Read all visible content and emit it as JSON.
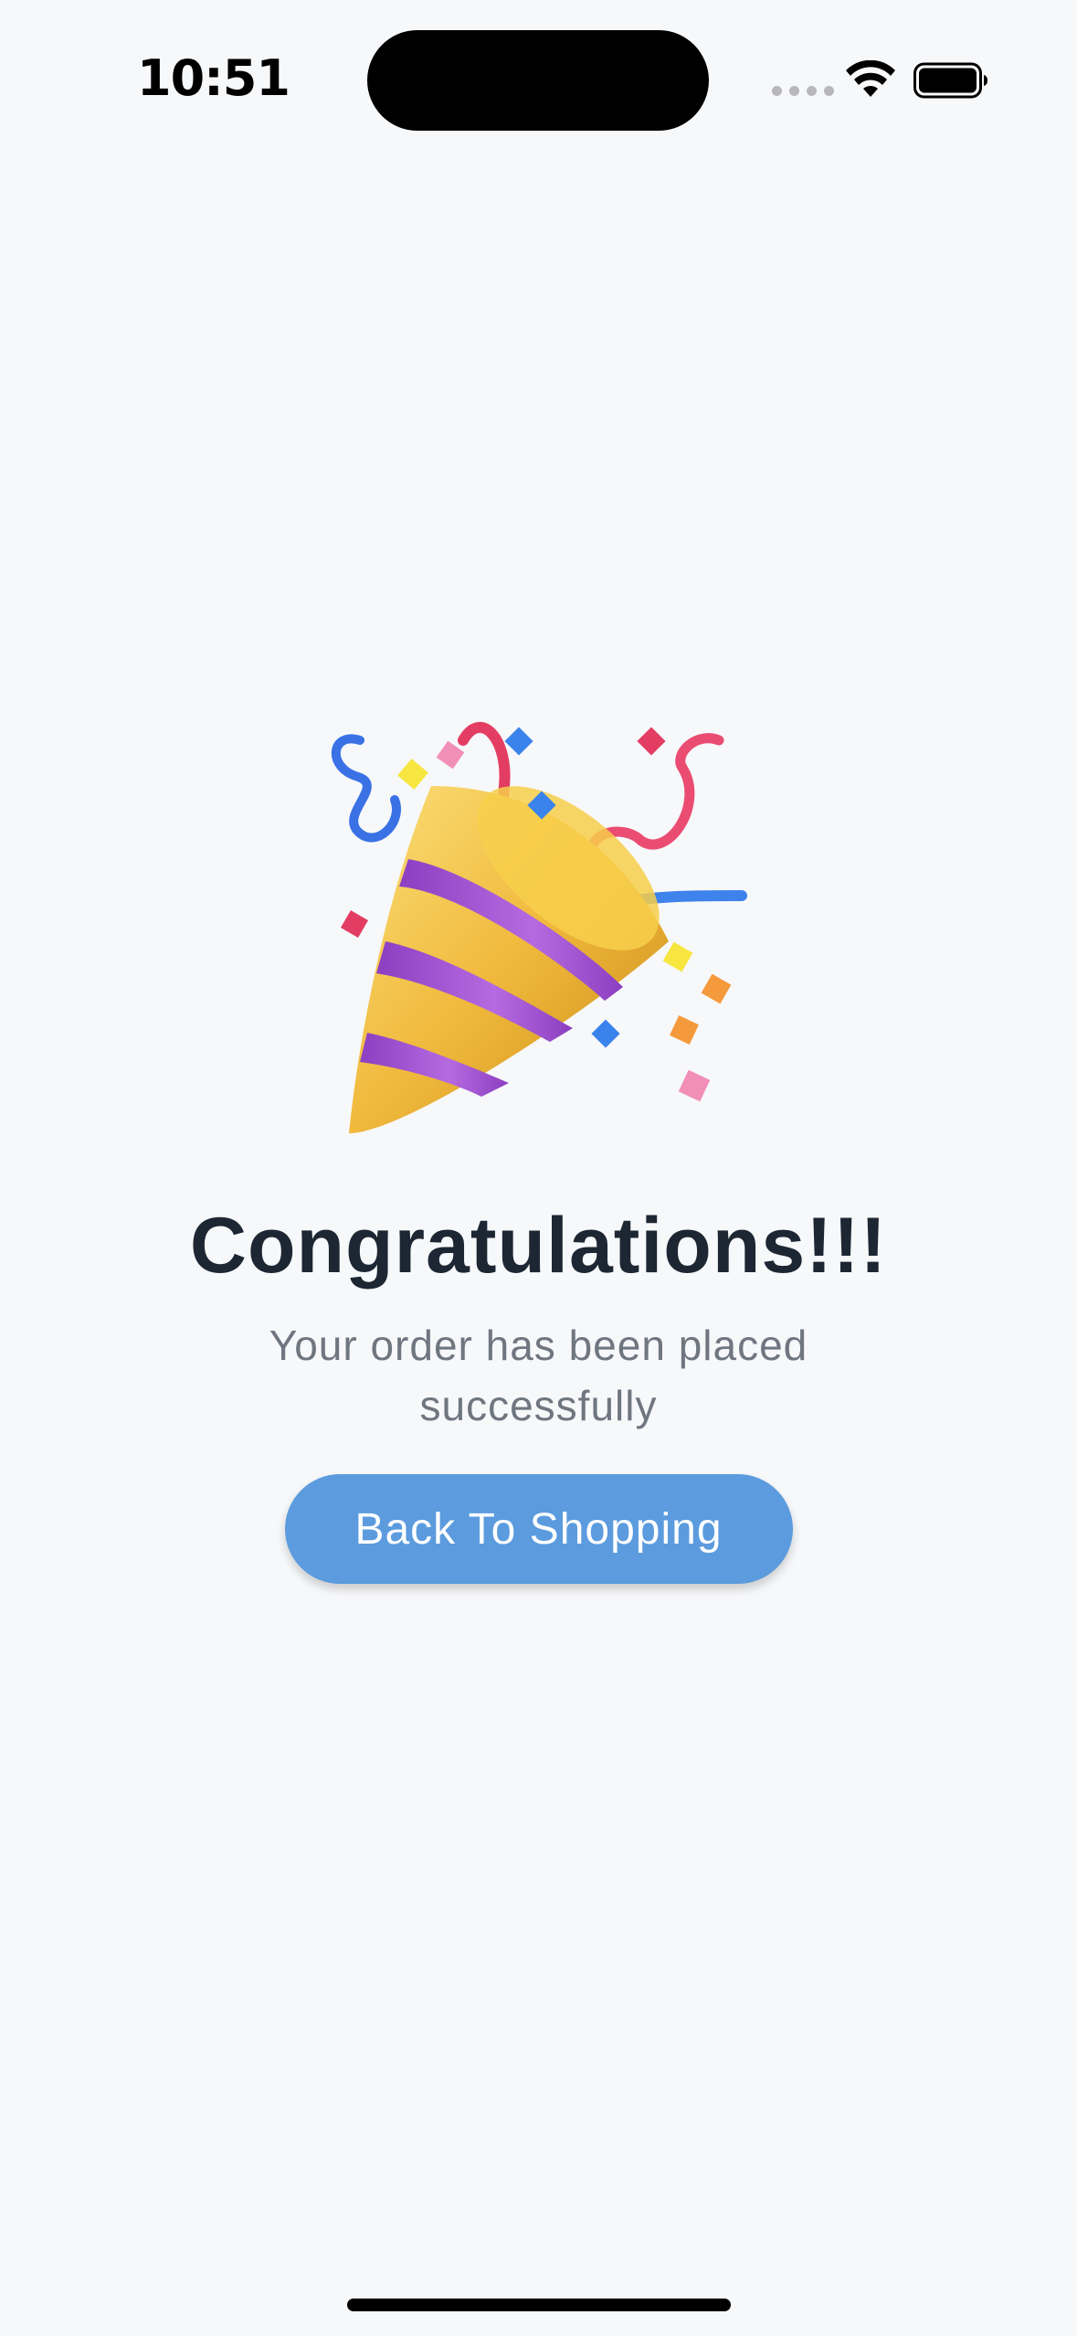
{
  "status_bar": {
    "time": "10:51"
  },
  "success": {
    "icon": "party-popper-icon",
    "title": "Congratulations!!!",
    "message": "Your order has been placed successfully",
    "button_label": "Back To Shopping"
  },
  "colors": {
    "background": "#f7f8fa",
    "title": "#1d2733",
    "subtitle": "#6f7680",
    "button": "#5b9bde",
    "button_text": "#ffffff"
  }
}
